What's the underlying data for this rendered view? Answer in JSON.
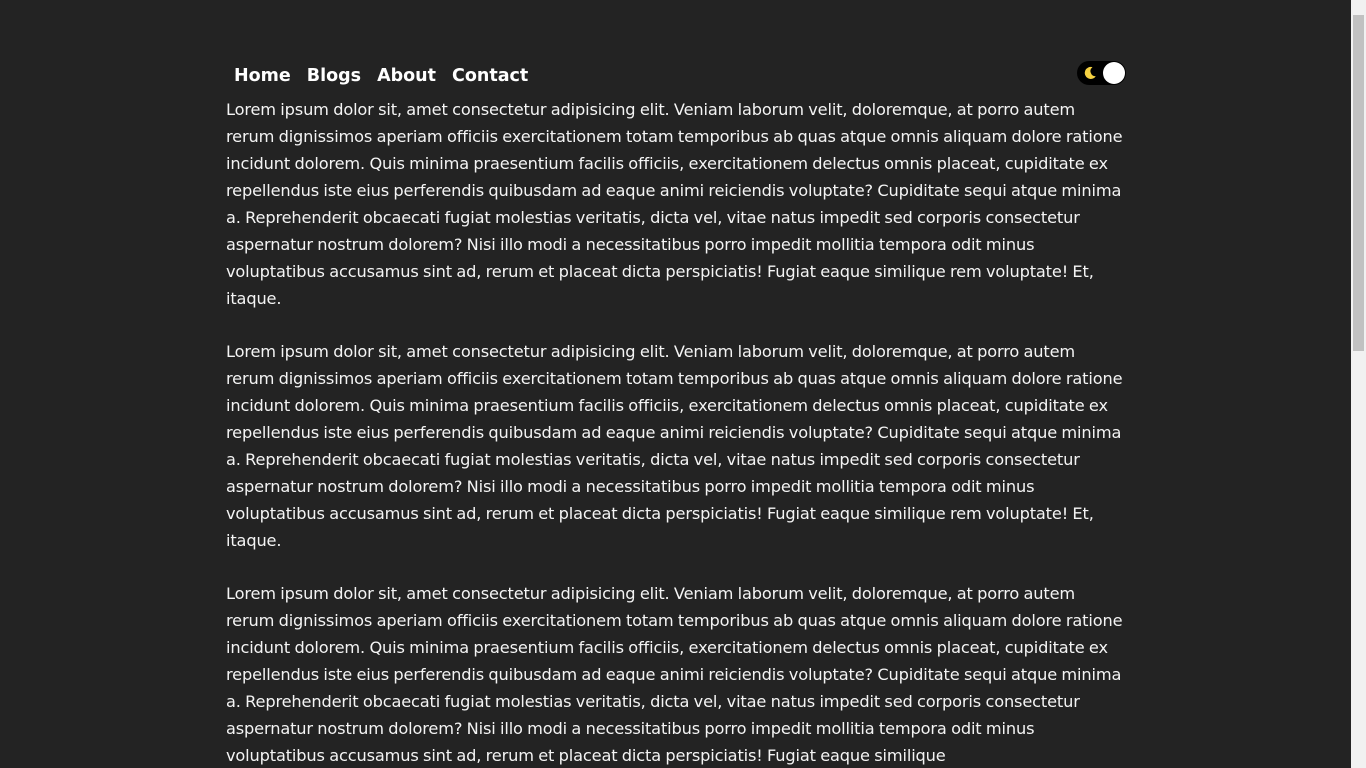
{
  "nav": {
    "links": [
      {
        "label": "Home"
      },
      {
        "label": "Blogs"
      },
      {
        "label": "About"
      },
      {
        "label": "Contact"
      }
    ],
    "theme_toggle": {
      "icon": "moon-icon",
      "state": "dark"
    }
  },
  "content": {
    "paragraphs": [
      "Lorem ipsum dolor sit, amet consectetur adipisicing elit. Veniam laborum velit, doloremque, at porro autem rerum dignissimos aperiam officiis exercitationem totam temporibus ab quas atque omnis aliquam dolore ratione incidunt dolorem. Quis minima praesentium facilis officiis, exercitationem delectus omnis placeat, cupiditate ex repellendus iste eius perferendis quibusdam ad eaque animi reiciendis voluptate? Cupiditate sequi atque minima a. Reprehenderit obcaecati fugiat molestias veritatis, dicta vel, vitae natus impedit sed corporis consectetur aspernatur nostrum dolorem? Nisi illo modi a necessitatibus porro impedit mollitia tempora odit minus voluptatibus accusamus sint ad, rerum et placeat dicta perspiciatis! Fugiat eaque similique rem voluptate! Et, itaque.",
      "Lorem ipsum dolor sit, amet consectetur adipisicing elit. Veniam laborum velit, doloremque, at porro autem rerum dignissimos aperiam officiis exercitationem totam temporibus ab quas atque omnis aliquam dolore ratione incidunt dolorem. Quis minima praesentium facilis officiis, exercitationem delectus omnis placeat, cupiditate ex repellendus iste eius perferendis quibusdam ad eaque animi reiciendis voluptate? Cupiditate sequi atque minima a. Reprehenderit obcaecati fugiat molestias veritatis, dicta vel, vitae natus impedit sed corporis consectetur aspernatur nostrum dolorem? Nisi illo modi a necessitatibus porro impedit mollitia tempora odit minus voluptatibus accusamus sint ad, rerum et placeat dicta perspiciatis! Fugiat eaque similique rem voluptate! Et, itaque.",
      "Lorem ipsum dolor sit, amet consectetur adipisicing elit. Veniam laborum velit, doloremque, at porro autem rerum dignissimos aperiam officiis exercitationem totam temporibus ab quas atque omnis aliquam dolore ratione incidunt dolorem. Quis minima praesentium facilis officiis, exercitationem delectus omnis placeat, cupiditate ex repellendus iste eius perferendis quibusdam ad eaque animi reiciendis voluptate? Cupiditate sequi atque minima a. Reprehenderit obcaecati fugiat molestias veritatis, dicta vel, vitae natus impedit sed corporis consectetur aspernatur nostrum dolorem? Nisi illo modi a necessitatibus porro impedit mollitia tempora odit minus voluptatibus accusamus sint ad, rerum et placeat dicta perspiciatis! Fugiat eaque similique"
    ]
  },
  "colors": {
    "background": "#232323",
    "text": "#f4f4f4",
    "nav_text": "#ffffff",
    "toggle_track": "#000000",
    "toggle_knob": "#ffffff",
    "moon": "#f5d142",
    "scrollbar_track": "#f1f1f1",
    "scrollbar_thumb": "#c1c1c1"
  }
}
